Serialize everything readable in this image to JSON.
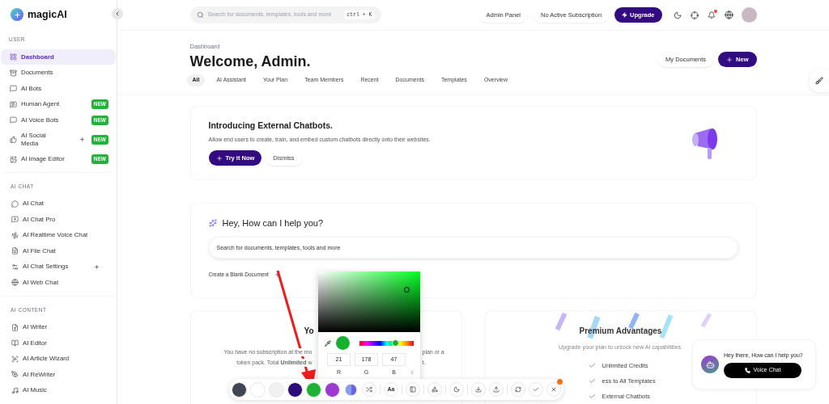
{
  "sidebar": {
    "logo": "magicAI",
    "sections": [
      {
        "title": "USER",
        "items": [
          {
            "label": "Dashboard",
            "selected": true,
            "submenu": false
          },
          {
            "label": "Documents",
            "selected": false,
            "submenu": false
          },
          {
            "label": "AI Bots",
            "selected": false,
            "submenu": false
          },
          {
            "label": "Human Agent",
            "selected": false,
            "badge": "NEW",
            "submenu": false
          },
          {
            "label": "AI Voice Bots",
            "selected": false,
            "badge": "NEW",
            "submenu": false
          },
          {
            "label": "AI Social Media",
            "selected": false,
            "badge": "NEW",
            "submenu": true
          },
          {
            "label": "AI Image Editor",
            "selected": false,
            "badge": "NEW",
            "submenu": false
          }
        ]
      },
      {
        "title": "AI CHAT",
        "items": [
          {
            "label": "AI Chat",
            "selected": false,
            "submenu": false
          },
          {
            "label": "AI Chat Pro",
            "selected": false,
            "submenu": false
          },
          {
            "label": "AI Realtime Voice Chat",
            "selected": false,
            "submenu": false
          },
          {
            "label": "AI File Chat",
            "selected": false,
            "submenu": false
          },
          {
            "label": "AI Chat Settings",
            "selected": false,
            "submenu": true
          },
          {
            "label": "AI Web Chat",
            "selected": false,
            "submenu": false
          }
        ]
      },
      {
        "title": "AI CONTENT",
        "items": [
          {
            "label": "AI Writer",
            "selected": false,
            "submenu": false
          },
          {
            "label": "AI Editor",
            "selected": false,
            "submenu": false
          },
          {
            "label": "AI Article Wizard",
            "selected": false,
            "submenu": false
          },
          {
            "label": "AI ReWriter",
            "selected": false,
            "submenu": false
          },
          {
            "label": "AI Music",
            "selected": false,
            "submenu": false
          }
        ]
      }
    ]
  },
  "header": {
    "search": {
      "placeholder": "Search for documents, templates, tools and more",
      "shortcut": "ctrl + K"
    },
    "admin_panel": "Admin Panel",
    "subscription": "No Active Subscription",
    "upgrade": "Upgrade",
    "notification": true
  },
  "page": {
    "breadcrumb": "Dashboard",
    "title": "Welcome, Admin.",
    "my_documents": "My Documents",
    "new": "New",
    "tabs": [
      {
        "label": "All",
        "selected": true
      },
      {
        "label": "AI Assistant",
        "selected": false
      },
      {
        "label": "Your Plan",
        "selected": false
      },
      {
        "label": "Team Members",
        "selected": false
      },
      {
        "label": "Recent",
        "selected": false
      },
      {
        "label": "Documents",
        "selected": false
      },
      {
        "label": "Templates",
        "selected": false
      },
      {
        "label": "Overview",
        "selected": false
      }
    ]
  },
  "announcement": {
    "title": "Introducing External Chatbots.",
    "description": "Allow end users to create, train, and embed custom chatbots directly onto their websites.",
    "primary": "Try it Now",
    "secondary": "Dismiss"
  },
  "assistant": {
    "title": "Hey, How can I help you?",
    "placeholder": "Search for documents, templates, tools and more",
    "create": "Create a Blank Document"
  },
  "subscription_card": {
    "title": "Yo",
    "lines": [
      {
        "left": "You have no subscription at the mo",
        "right": "plan or a"
      },
      {
        "left": "token pack. Total **Unlimited** w",
        "right": "t."
      }
    ]
  },
  "premium": {
    "title": "Premium Advantages",
    "subtitle": "Upgrade your plan to unlock new AI capabilities.",
    "items": [
      {
        "label": "Unlimited Credits"
      },
      {
        "label": "ess to All Templates"
      },
      {
        "label": "External Chatbots"
      }
    ]
  },
  "color_picker": {
    "color": "#15b22f",
    "level": 0.66,
    "values": [
      {
        "label": "R",
        "value": "21"
      },
      {
        "label": "G",
        "value": "178"
      },
      {
        "label": "B",
        "value": "47"
      }
    ]
  },
  "toolbar": {
    "swatches": [
      {
        "color": "#3f4654",
        "kind": "solid",
        "selected": false
      },
      {
        "color": "#ffffff",
        "kind": "solid",
        "selected": false
      },
      {
        "color": "#f1f1f1",
        "kind": "solid",
        "selected": false
      },
      {
        "color": "#2e0b7a",
        "kind": "solid",
        "selected": false
      },
      {
        "color": "#1fb135",
        "kind": "solid",
        "selected": true
      },
      {
        "color": "#9b3bd1",
        "kind": "solid",
        "selected": false
      },
      {
        "color": "#8a9cf0",
        "kind": "gradient",
        "selected": false
      }
    ],
    "font_label": "Aa"
  },
  "chat_widget": {
    "message": "Hey there, How can I help you?",
    "button": "Voice Chat"
  }
}
